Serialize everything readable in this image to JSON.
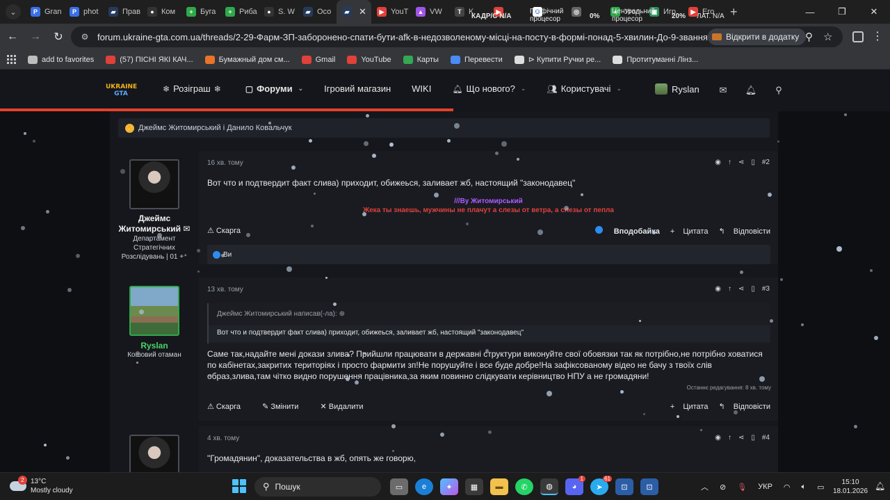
{
  "browser": {
    "tabs": [
      {
        "label": "Gran",
        "color": "#3b6fe6",
        "glyph": "P"
      },
      {
        "label": "phot",
        "color": "#3b6fe6",
        "glyph": "P"
      },
      {
        "label": "Прав",
        "color": "#263a5a",
        "glyph": "▰"
      },
      {
        "label": "Ком",
        "color": "#333333",
        "glyph": "●"
      },
      {
        "label": "Буга",
        "color": "#2fa84b",
        "glyph": "+"
      },
      {
        "label": "Риба",
        "color": "#2fa84b",
        "glyph": "+"
      },
      {
        "label": "S. W",
        "color": "#333333",
        "glyph": "●"
      },
      {
        "label": "Осо",
        "color": "#263a5a",
        "glyph": "▰"
      },
      {
        "label": "",
        "color": "#263a5a",
        "glyph": "▰",
        "active": true
      },
      {
        "label": "YouT",
        "color": "#e0413a",
        "glyph": "▶"
      },
      {
        "label": "VW",
        "color": "#a055e8",
        "glyph": "▲"
      },
      {
        "label": "K",
        "color": "#444444",
        "glyph": "T"
      },
      {
        "label": "",
        "color": "#e0413a",
        "glyph": "▶"
      },
      {
        "label": "",
        "color": "#ffffff",
        "glyph": "G"
      },
      {
        "label": "",
        "color": "#666666",
        "glyph": "◎"
      },
      {
        "label": "Угод",
        "color": "#2fa84b",
        "glyph": "+"
      },
      {
        "label": "Игр",
        "color": "#2a8f5a",
        "glyph": "▣"
      },
      {
        "label": "Его",
        "color": "#e0413a",
        "glyph": "▶"
      }
    ],
    "tab_overlay_1": "КАДР/С N/A",
    "tab_overlay_2": "Графічний процесор",
    "tab_overlay_3": "0%",
    "tab_overlay_4": "Центральний процесор",
    "tab_overlay_5": "20%",
    "tab_overlay_6": "ЛАТ. N/A",
    "url": "forum.ukraine-gta.com.ua/threads/2-29-Фарм-ЗП-заборонено-спати-бути-afk-в-недозволеному-місці-на-посту-в-формі-понад-5-хвилин-До-9-звання-надається-...",
    "open_in_app": "Відкрити в додатку",
    "bookmarks": [
      {
        "label": "add to favorites",
        "color": "#bdbdbd"
      },
      {
        "label": "(57) ПІСНІ ЯКІ КАЧ...",
        "color": "#e0413a"
      },
      {
        "label": "Бумажный дом см...",
        "color": "#e8732b"
      },
      {
        "label": "Gmail",
        "color": "#e0413a"
      },
      {
        "label": "YouTube",
        "color": "#e0413a"
      },
      {
        "label": "Карты",
        "color": "#34a853"
      },
      {
        "label": "Перевести",
        "color": "#4b8bf5"
      },
      {
        "label": "⊳ Купити Ручки ре...",
        "color": "#dddddd"
      },
      {
        "label": "Протитуманні Лінз...",
        "color": "#dddddd"
      }
    ]
  },
  "forum": {
    "logo_top": "UKRAINE",
    "logo_bottom": "GTA",
    "nav": {
      "giveaway": "Розіграш",
      "forums": "Форуми",
      "store": "Ігровий магазин",
      "wiki": "WIKI",
      "whats_new": "Що нового?",
      "users": "Користувачі"
    },
    "username": "Ryslan",
    "reactions_top": "Джеймс Житомирський і Данило Ковальчук",
    "posts": [
      {
        "author": "Джеймс Житомирський",
        "author_title": "Департамент Стратегічних Розслідувань | 01 +⁺",
        "time": "16 хв. тому",
        "num": "#2",
        "text": "Вот что и подтвердит факт слива) приходит, обижеься, заливает жб, настоящий \"законодавец\"",
        "sig_line1": "///By Житомирський",
        "sig_line2": "Жека ты знаешь, мужчины не плачут а слезы от ветра, а слезы от пепла",
        "report": "Скарга",
        "like": "Вподобайка",
        "quote": "Цитата",
        "reply": "Відповісти",
        "likes_text": "Ви"
      },
      {
        "author": "Ryslan",
        "author_title": "Кошовий отаман",
        "time": "13 хв. тому",
        "num": "#3",
        "quote_header": "Джеймс Житомирський написав(-ла):",
        "quote_text": "Вот что и подтвердит факт слива) приходит, обижеься, заливает жб, настоящий \"законодавец\"",
        "text": "Саме так,надайте мені докази злива? Прийшли працювати в державні структури виконуйте свої обовязки так як потрібно,не потрібно ховатися по кабінетах,закритих територіях і просто фармити зп!Не порушуйте і все буде добре!На зафіксованому відео не бачу з твоїх слів образ,злива,там чітко видно порушення працівника,за яким повинно слідкувати керівництво НПУ а не громадяни!",
        "edited": "Останнє редагування: 8 хв. тому",
        "report": "Скарга",
        "edit": "Змінити",
        "delete": "Видалити",
        "quote": "Цитата",
        "reply": "Відповісти"
      },
      {
        "time": "4 хв. тому",
        "num": "#4",
        "text": "\"Громадянин\", доказательства в жб, опять же говорю,"
      }
    ]
  },
  "taskbar": {
    "weather_badge": "2",
    "temp": "13°C",
    "condition": "Mostly cloudy",
    "search": "Пошук",
    "lang": "УКР",
    "time": "15:10",
    "date": "18.01.2026",
    "discord_badge": "1",
    "telegram_badge": "61"
  }
}
